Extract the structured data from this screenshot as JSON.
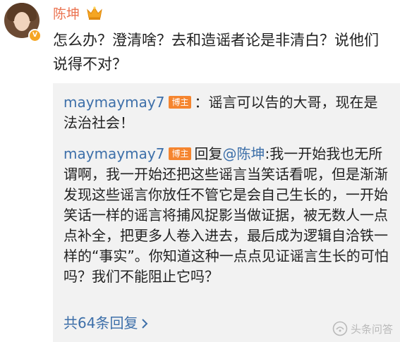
{
  "post": {
    "author": "陈坤",
    "text": "怎么办？澄清啥？去和造谣者论是非清白？说他们说得不对？",
    "verified_badge": "V"
  },
  "replies": [
    {
      "author": "maymaymay7",
      "tag": "博主",
      "text": "：谣言可以告的大哥，现在是法治社会！"
    },
    {
      "author": "maymaymay7",
      "tag": "博主",
      "reply_prefix": "回复",
      "mention": "@陈坤",
      "text": ":我一开始我也无所谓啊，我一开始还把这些谣言当笑话看呢，但是渐渐发现这些谣言你放任不管它是会自己生长的，一开始笑话一样的谣言将捕风捉影当做证据，被无数人一点点补全，把更多人卷入进去，最后成为逻辑自洽铁一样的“事实”。你知道这种一点点见证谣言生长的可怕吗？我们不能阻止它吗？"
    }
  ],
  "more_replies": "共64条回复",
  "watermark": "头条问答",
  "colors": {
    "username": "#eb7350",
    "link": "#3d6fa9",
    "tag": "#f5852f",
    "reply_bg": "#f2f2f2"
  },
  "icons": [
    "crown-icon",
    "chevron-right-icon",
    "toutiao-logo-icon"
  ]
}
